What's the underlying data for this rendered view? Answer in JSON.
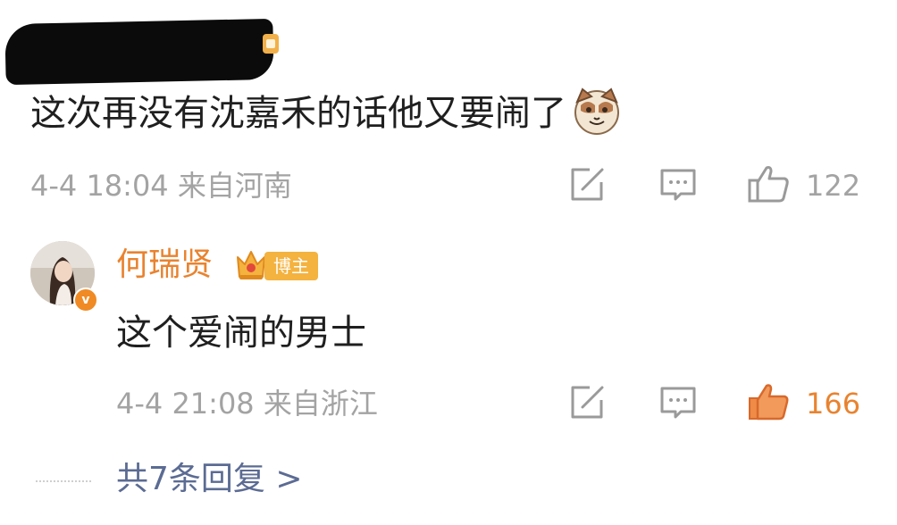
{
  "comment": {
    "text": "这次再没有沈嘉禾的话他又要闹了",
    "emoji": "cat-face-emoji",
    "time": "4-4 18:04",
    "location": "来自河南",
    "likes": "122",
    "icons": [
      "redacted-username",
      "share-icon",
      "comment-icon",
      "like-icon"
    ]
  },
  "reply": {
    "username": "何瑞贤",
    "badge_label": "博主",
    "verified_mark": "v",
    "text": "这个爱闹的男士",
    "time": "4-4 21:08",
    "location": "来自浙江",
    "likes": "166",
    "icons": [
      "avatar",
      "crown-icon",
      "share-icon",
      "comment-icon",
      "like-icon-active"
    ]
  },
  "more_replies_label": "共7条回复 >",
  "colors": {
    "accent": "#e9832f",
    "meta_gray": "#a3a3a3",
    "link_blue": "#5b6b93",
    "like_active": "#ef8a47"
  }
}
